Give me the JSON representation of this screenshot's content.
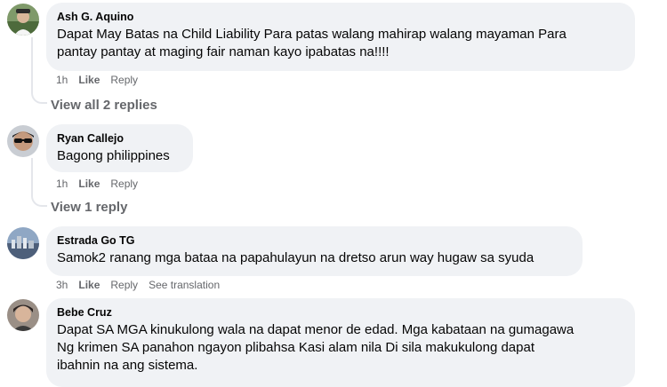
{
  "comments": [
    {
      "author": "Ash G. Aquino",
      "text_line1": "Dapat May Batas na Child Liability Para patas walang mahirap walang mayaman Para",
      "text_line2": "pantay pantay at maging fair naman kayo ipabatas na!!!!",
      "time": "1h",
      "like": "Like",
      "reply": "Reply",
      "replies_link": "View all 2 replies"
    },
    {
      "author": "Ryan Callejo",
      "text": "Bagong philippines",
      "time": "1h",
      "like": "Like",
      "reply": "Reply",
      "replies_link": "View 1 reply"
    },
    {
      "author": "Estrada Go TG",
      "text": "Samok2 ranang mga bataa na papahulayun na dretso arun way hugaw sa syuda",
      "time": "3h",
      "like": "Like",
      "reply": "Reply",
      "translation": "See translation"
    },
    {
      "author": "Bebe Cruz",
      "text_line1": "Dapat SA MGA kinukulong wala na dapat menor de edad. Mga kabataan na gumagawa",
      "text_line2": "Ng krimen SA panahon ngayon plibahsa Kasi alam nila Di sila makukulong dapat",
      "text_line3": "ibahnin na ang sistema."
    }
  ],
  "colors": {
    "bubble": "#f0f2f5",
    "meta_text": "#65676b",
    "text": "#050505",
    "thread": "#e4e6eb"
  }
}
